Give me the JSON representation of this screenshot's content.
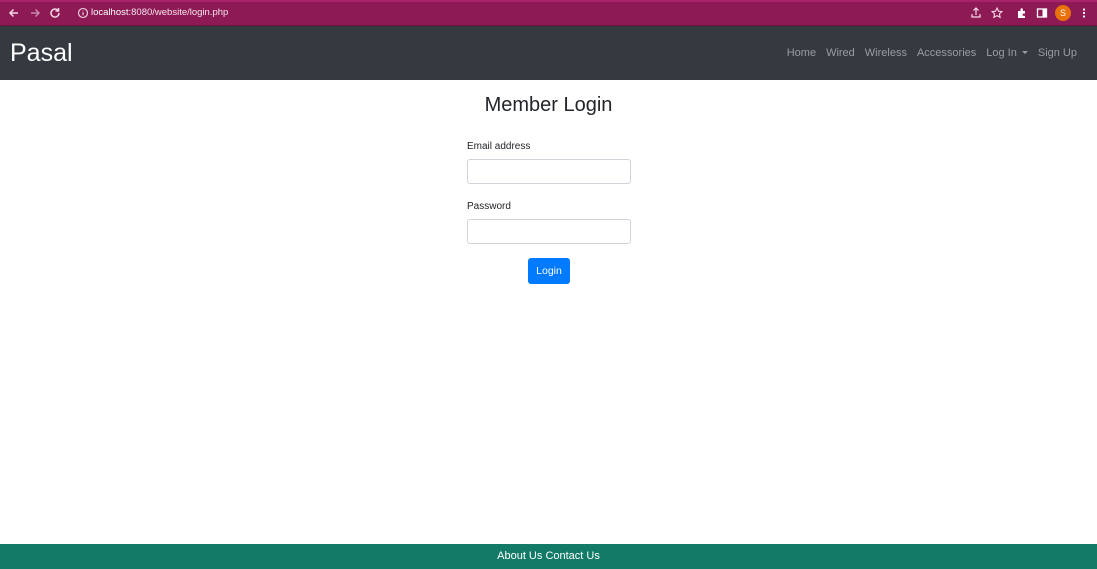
{
  "browser": {
    "url_host": "localhost",
    "url_rest": ":8080/website/login.php",
    "profile_initial": "S",
    "icons": [
      "back-icon",
      "forward-icon",
      "reload-icon",
      "info-icon",
      "share-icon",
      "star-icon",
      "extensions-icon",
      "side-panel-icon",
      "menu-icon"
    ],
    "accent_color": "#8d1a55"
  },
  "navbar": {
    "brand": "Pasal",
    "links": [
      "Home",
      "Wired",
      "Wireless",
      "Accessories",
      "Log In",
      "Sign Up"
    ],
    "background": "#343a40"
  },
  "form": {
    "title": "Member Login",
    "email_label": "Email address",
    "email_value": "",
    "password_label": "Password",
    "password_value": "",
    "submit_label": "Login",
    "button_color": "#007bff"
  },
  "footer": {
    "links": [
      "About Us",
      "Contact Us"
    ],
    "background": "#127a66"
  }
}
